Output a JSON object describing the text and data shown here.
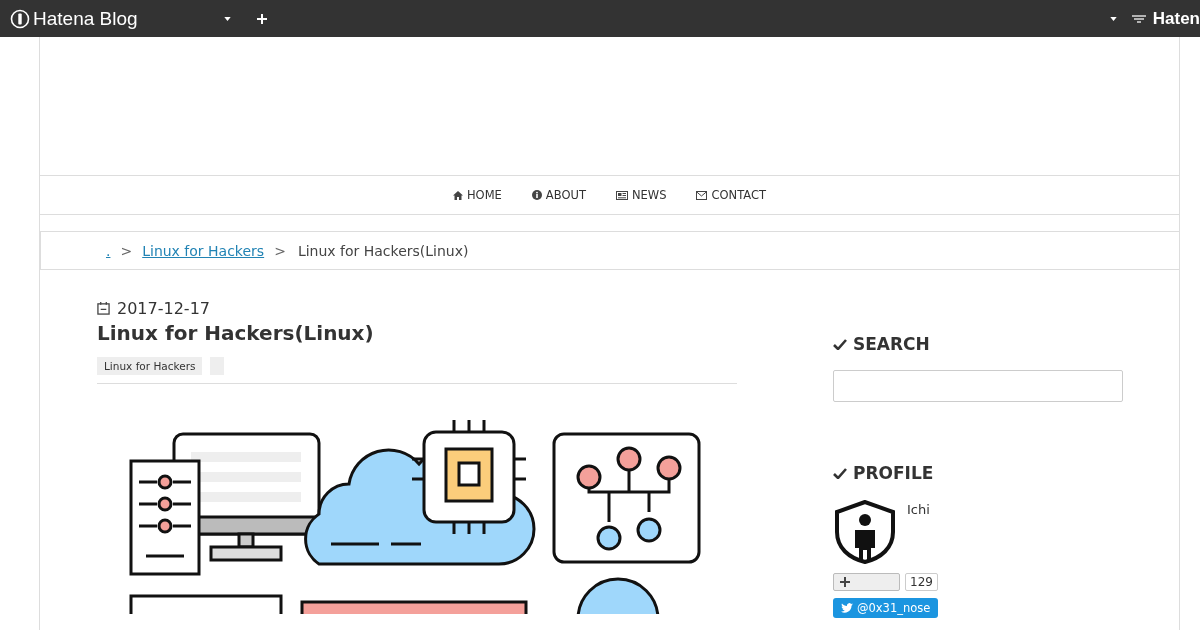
{
  "topbar": {
    "logo": "Hatena Blog",
    "right_logo": "Haten"
  },
  "nav": [
    {
      "label": "HOME",
      "kind": "home"
    },
    {
      "label": "ABOUT",
      "kind": "info"
    },
    {
      "label": "NEWS",
      "kind": "news"
    },
    {
      "label": "CONTACT",
      "kind": "mail"
    }
  ],
  "breadcrumb": [
    {
      "label": ".",
      "kind": "link"
    },
    {
      "label": "Linux for Hackers",
      "kind": "link"
    },
    {
      "label": "Linux for Hackers(Linux)",
      "kind": "current"
    }
  ],
  "separator": ">",
  "article": {
    "date": "2017-12-17",
    "title": "Linux for Hackers(Linux)",
    "tags": [
      "Linux for Hackers"
    ]
  },
  "sidebar": {
    "search": {
      "heading": "SEARCH"
    },
    "profile": {
      "heading": "PROFILE",
      "name": "Ichi",
      "subscribers": "129",
      "twitter": "@0x31_nose"
    }
  }
}
